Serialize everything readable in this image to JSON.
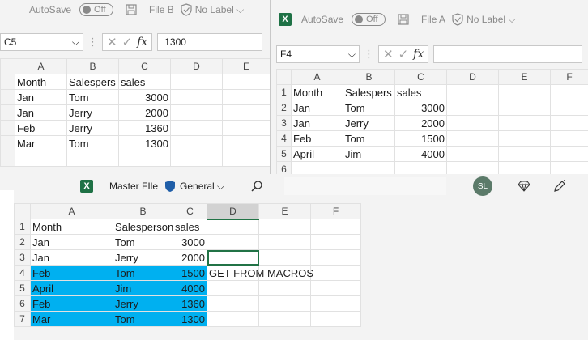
{
  "window_b": {
    "autosave_label": "AutoSave",
    "autosave_state": "Off",
    "file_name": "File B",
    "label_text": "No Label",
    "name_box": "C5",
    "formula_value": "1300",
    "columns": [
      "A",
      "B",
      "C",
      "D",
      "E"
    ],
    "rows": [
      [
        "Month",
        "Salespers",
        "sales",
        "",
        ""
      ],
      [
        "Jan",
        "Tom",
        "3000",
        "",
        ""
      ],
      [
        "Jan",
        "Jerry",
        "2000",
        "",
        ""
      ],
      [
        "Feb",
        "Jerry",
        "1360",
        "",
        ""
      ],
      [
        "Mar",
        "Tom",
        "1300",
        "",
        ""
      ]
    ]
  },
  "window_a": {
    "autosave_label": "AutoSave",
    "autosave_state": "Off",
    "file_name": "File A",
    "label_text": "No Label",
    "name_box": "F4",
    "formula_value": "",
    "columns": [
      "A",
      "B",
      "C",
      "D",
      "E",
      "F"
    ],
    "row_numbers": [
      "1",
      "2",
      "3",
      "4",
      "5",
      "6"
    ],
    "rows": [
      [
        "Month",
        "Salespers",
        "sales",
        "",
        "",
        ""
      ],
      [
        "Jan",
        "Tom",
        "3000",
        "",
        "",
        ""
      ],
      [
        "Jan",
        "Jerry",
        "2000",
        "",
        "",
        ""
      ],
      [
        "Feb",
        "Tom",
        "1500",
        "",
        "",
        ""
      ],
      [
        "April",
        "Jim",
        "4000",
        "",
        "",
        ""
      ],
      [
        "",
        "",
        "",
        "",
        "",
        ""
      ]
    ]
  },
  "window_master": {
    "file_name": "Master FIle",
    "sensitivity_label": "General",
    "avatar_initials": "SL",
    "columns": [
      "A",
      "B",
      "C",
      "D",
      "E",
      "F"
    ],
    "row_numbers": [
      "1",
      "2",
      "3",
      "4",
      "5",
      "6",
      "7"
    ],
    "rows": [
      [
        "Month",
        "Salesperson",
        "sales",
        "",
        "",
        ""
      ],
      [
        "Jan",
        "Tom",
        "3000",
        "",
        "",
        ""
      ],
      [
        "Jan",
        "Jerry",
        "2000",
        "",
        "",
        ""
      ],
      [
        "Feb",
        "Tom",
        "1500",
        "GET FROM MACROS",
        "",
        ""
      ],
      [
        "April",
        "Jim",
        "4000",
        "",
        "",
        ""
      ],
      [
        "Feb",
        "Jerry",
        "1360",
        "",
        "",
        ""
      ],
      [
        "Mar",
        "Tom",
        "1300",
        "",
        "",
        ""
      ]
    ],
    "highlight_color": "#00b0f0"
  },
  "icons": {
    "save": "save-icon",
    "label": "sensitivity-label-icon",
    "search": "search-icon",
    "diamond": "premium-diamond-icon",
    "pen": "pen-icon"
  }
}
